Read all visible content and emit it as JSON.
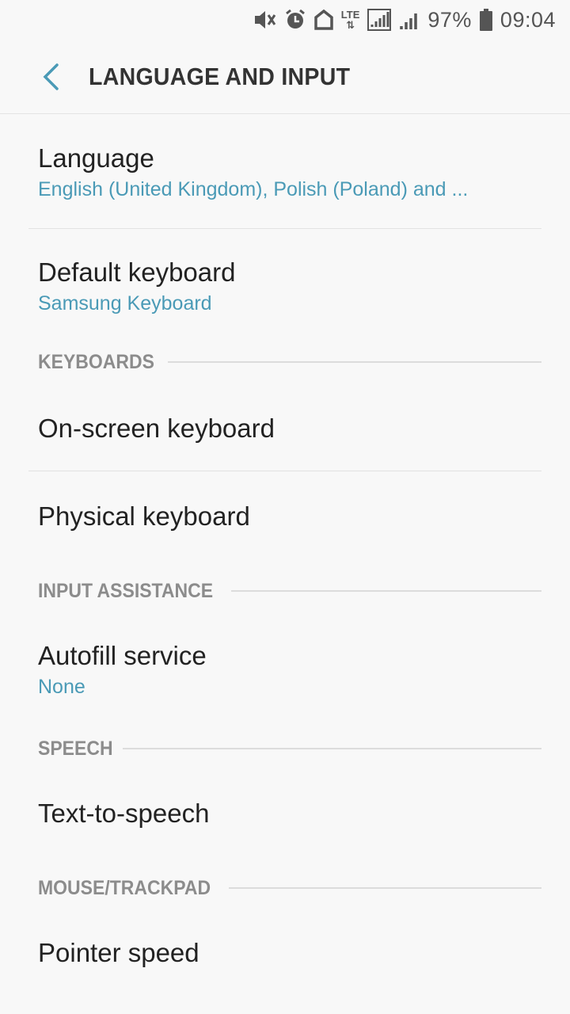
{
  "status_bar": {
    "battery_percent": "97%",
    "time": "09:04",
    "network_type": "LTE"
  },
  "app_bar": {
    "title": "LANGUAGE AND INPUT"
  },
  "items": {
    "language": {
      "title": "Language",
      "subtitle": "English (United Kingdom), Polish (Poland) and ..."
    },
    "default_keyboard": {
      "title": "Default keyboard",
      "subtitle": "Samsung Keyboard"
    },
    "on_screen_keyboard": {
      "title": "On-screen keyboard"
    },
    "physical_keyboard": {
      "title": "Physical keyboard"
    },
    "autofill_service": {
      "title": "Autofill service",
      "subtitle": "None"
    },
    "text_to_speech": {
      "title": "Text-to-speech"
    },
    "pointer_speed": {
      "title": "Pointer speed"
    }
  },
  "sections": {
    "keyboards": "KEYBOARDS",
    "input_assistance": "INPUT ASSISTANCE",
    "speech": "SPEECH",
    "mouse_trackpad": "MOUSE/TRACKPAD"
  },
  "colors": {
    "accent": "#4a9ab6",
    "section_label": "#8c8c8c",
    "background": "#f8f8f8"
  }
}
